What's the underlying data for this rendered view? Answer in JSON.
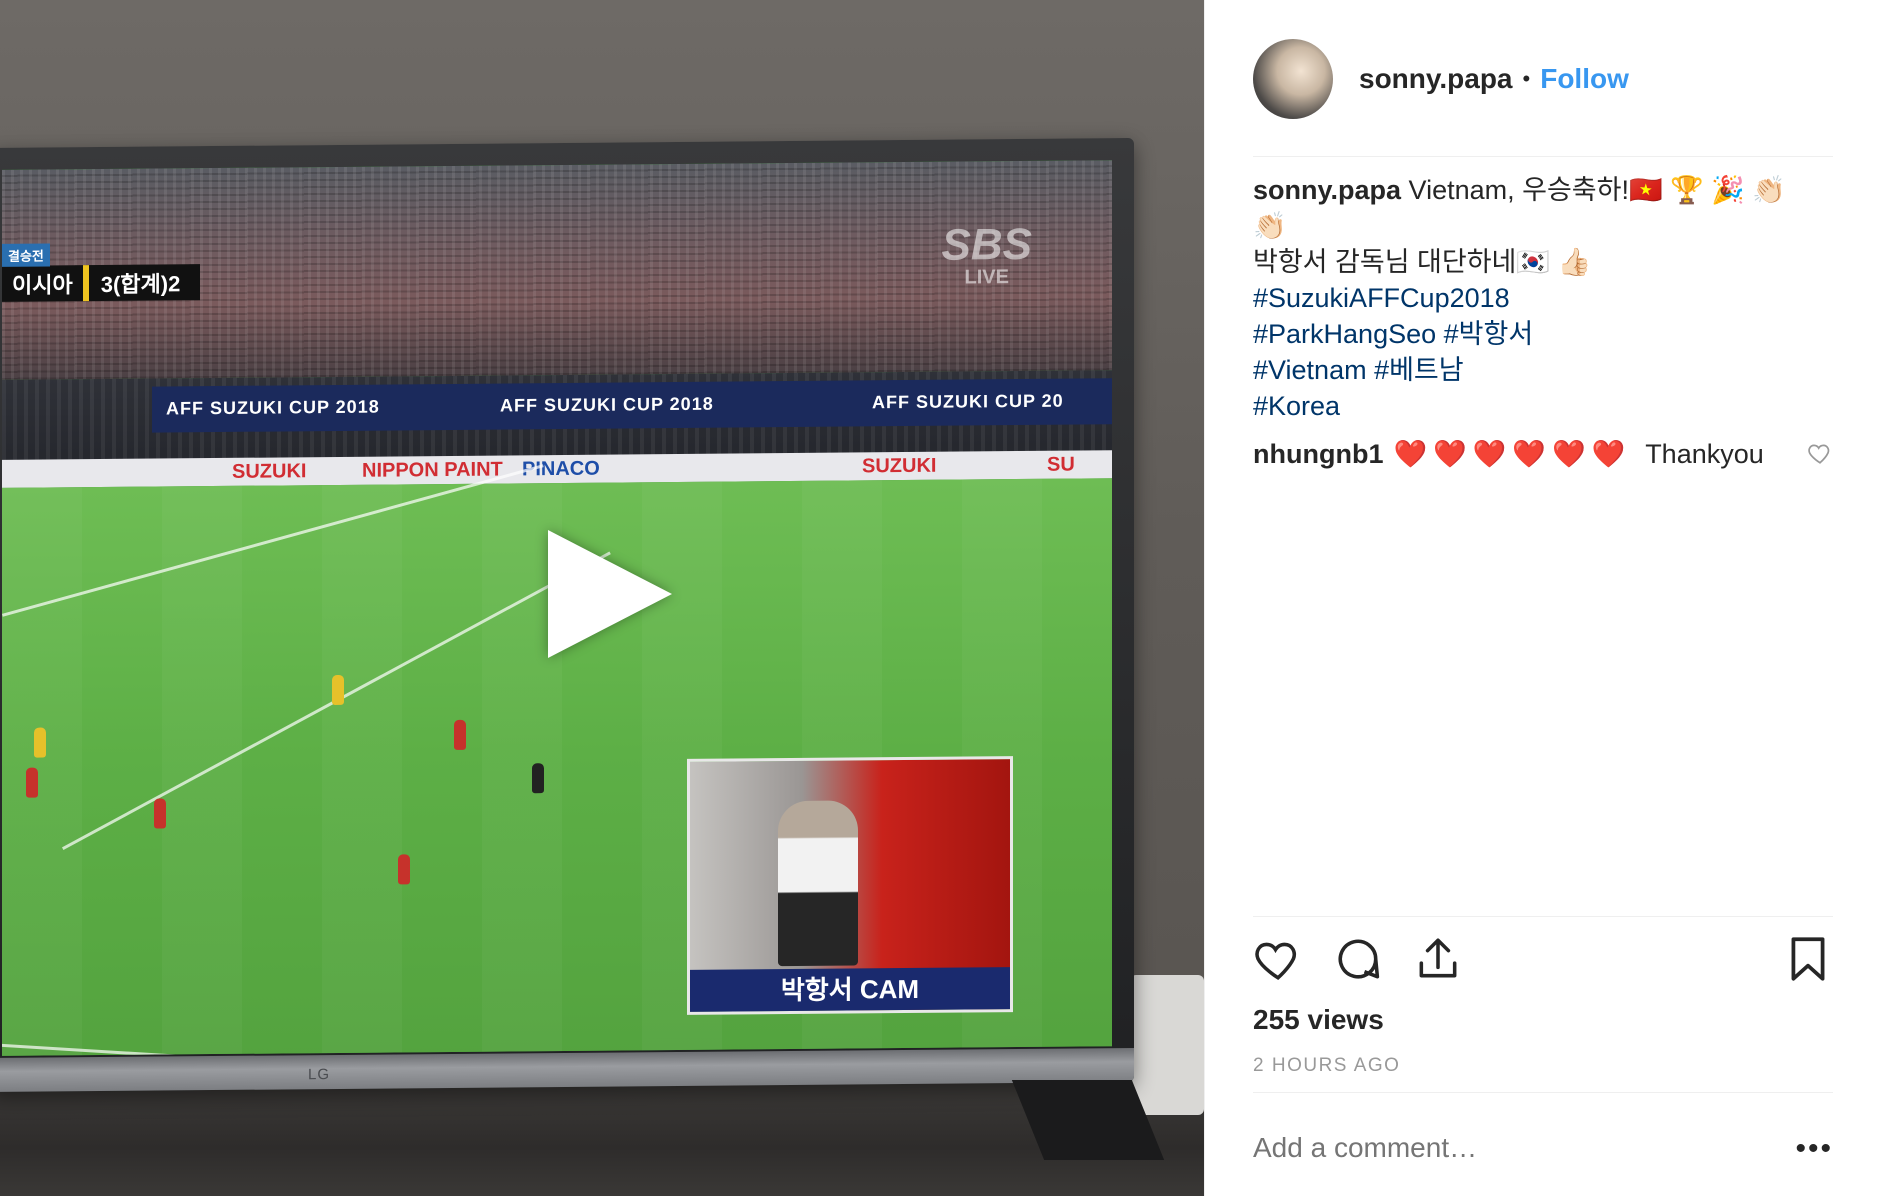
{
  "video": {
    "scoreboard_tag": "결승전",
    "scoreboard_team": "이시아",
    "scoreboard_score": "3(합계)2",
    "broadcaster": "SBS",
    "broadcaster_sub": "LIVE",
    "banner_1": "AFF SUZUKI CUP 2018",
    "banner_2": "AFF SUZUKI CUP 2018",
    "banner_3": "AFF SUZUKI CUP 20",
    "ads": [
      "SUZUKI",
      "NIPPON PAINT",
      "PINACO",
      "SUZUKI",
      "SU"
    ],
    "pip_label": "박항서 CAM",
    "tv_brand": "LG",
    "play_icon": "play-icon"
  },
  "post": {
    "username": "sonny.papa",
    "separator": "•",
    "follow_label": "Follow",
    "caption_user": "sonny.papa",
    "caption_line1": "Vietnam, 우승축하!🇻🇳 🏆 🎉 👏🏻",
    "caption_line1b": "👏🏻",
    "caption_line2": "박항서 감독님 대단하네🇰🇷 👍🏻",
    "hashtags": [
      "#SuzukiAFFCup2018",
      "#ParkHangSeo #박항서",
      "#Vietnam #베트남",
      "#Korea"
    ],
    "comment_user": "nhungnb1",
    "comment_hearts": "❤️❤️❤️❤️❤️❤️",
    "comment_text": "Thankyou",
    "views": "255 views",
    "time": "2 HOURS AGO",
    "comment_placeholder": "Add a comment…",
    "more_label": "•••"
  },
  "icons": [
    "heart-icon",
    "comment-icon",
    "share-icon",
    "bookmark-icon",
    "small-heart-icon"
  ],
  "colors": {
    "link": "#3897f0",
    "hashtag": "#003569",
    "muted": "#999999"
  }
}
